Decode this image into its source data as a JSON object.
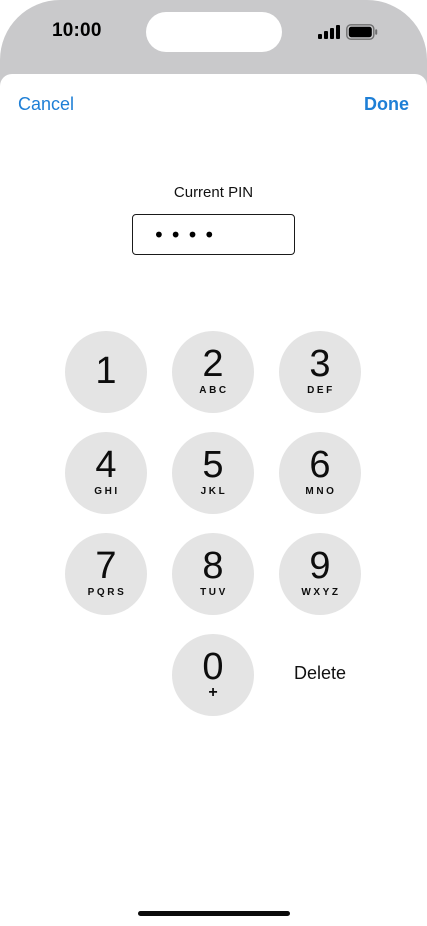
{
  "status_bar": {
    "time": "10:00",
    "signal_icon": "cellular-signal-icon",
    "battery_icon": "battery-full-icon"
  },
  "nav": {
    "cancel_label": "Cancel",
    "done_label": "Done"
  },
  "pin": {
    "label": "Current PIN",
    "masked_value": "••••"
  },
  "keypad": {
    "keys": [
      {
        "digit": "1",
        "letters": ""
      },
      {
        "digit": "2",
        "letters": "ABC"
      },
      {
        "digit": "3",
        "letters": "DEF"
      },
      {
        "digit": "4",
        "letters": "GHI"
      },
      {
        "digit": "5",
        "letters": "JKL"
      },
      {
        "digit": "6",
        "letters": "MNO"
      },
      {
        "digit": "7",
        "letters": "PQRS"
      },
      {
        "digit": "8",
        "letters": "TUV"
      },
      {
        "digit": "9",
        "letters": "WXYZ"
      },
      {
        "digit": "0",
        "letters": "+"
      }
    ],
    "delete_label": "Delete"
  },
  "colors": {
    "accent": "#1e7fd6",
    "key_background": "#e4e4e4",
    "frame": "#c9c9cb"
  }
}
